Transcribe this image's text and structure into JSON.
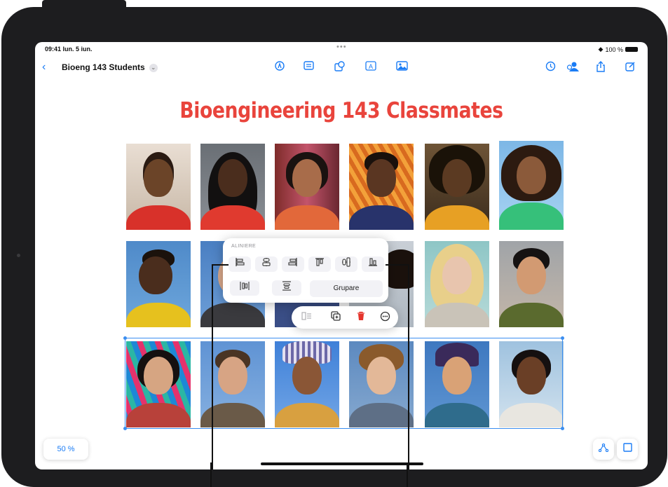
{
  "status_bar": {
    "time": "09:41 lun. 5 iun.",
    "dots": "•••",
    "battery": "100 %"
  },
  "toolbar": {
    "title": "Bioeng 143 Students",
    "icons": [
      "back-icon",
      "pen-icon",
      "text-box-icon",
      "shape-icon",
      "text-icon",
      "media-icon",
      "undo-history-icon",
      "collaborate-icon",
      "share-icon",
      "compose-icon"
    ]
  },
  "board": {
    "title": "Bioengineering 143 Classmates",
    "photo_count": 18
  },
  "align_popover": {
    "heading": "ALINIERE",
    "group_label": "Grupare"
  },
  "context_bar": {
    "icons": [
      "align-menu-icon",
      "duplicate-icon",
      "delete-icon",
      "more-icon"
    ]
  },
  "bottom": {
    "zoom": "50 %",
    "icons": [
      "connector-icon",
      "shape-toggle-icon"
    ]
  },
  "colors": {
    "accent": "#1a7cf5",
    "title_red": "#e9443c",
    "selection": "#3b8ef0",
    "delete_red": "#e5342b"
  }
}
